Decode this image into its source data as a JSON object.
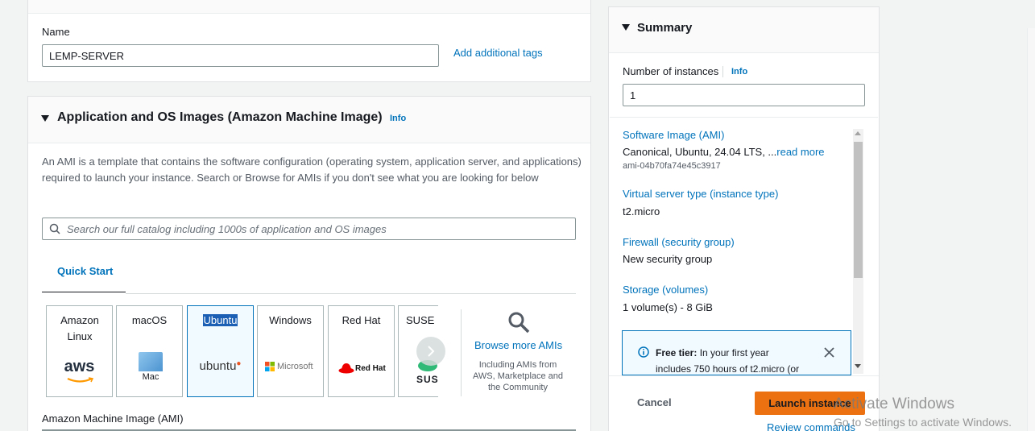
{
  "name_section": {
    "label": "Name",
    "value": "LEMP-SERVER",
    "add_tags": "Add additional tags"
  },
  "ami_section": {
    "title": "Application and OS Images (Amazon Machine Image)",
    "info": "Info",
    "description": "An AMI is a template that contains the software configuration (operating system, application server, and applications) required to launch your instance. Search or Browse for AMIs if you don't see what you are looking for below",
    "search_placeholder": "Search our full catalog including 1000s of application and OS images",
    "tab": "Quick Start",
    "tiles": [
      {
        "name": "Amazon Linux",
        "logo": "aws"
      },
      {
        "name": "macOS",
        "logo": "Mac"
      },
      {
        "name": "Ubuntu",
        "logo": "ubuntu"
      },
      {
        "name": "Windows",
        "logo": "Microsoft"
      },
      {
        "name": "Red Hat",
        "logo": "Red Hat"
      },
      {
        "name": "SUSE L",
        "logo": "SUS"
      }
    ],
    "browse_more": "Browse more AMIs",
    "browse_sub": "Including AMIs from AWS, Marketplace and the Community",
    "ami_label": "Amazon Machine Image (AMI)"
  },
  "summary": {
    "title": "Summary",
    "instances_label": "Number of instances",
    "info": "Info",
    "instances_value": "1",
    "software_image_label": "Software Image (AMI)",
    "software_image_value": "Canonical, Ubuntu, 24.04 LTS, ...",
    "read_more": "read more",
    "ami_id": "ami-04b70fa74e45c3917",
    "instance_type_label": "Virtual server type (instance type)",
    "instance_type_value": "t2.micro",
    "firewall_label": "Firewall (security group)",
    "firewall_value": "New security group",
    "storage_label": "Storage (volumes)",
    "storage_value": "1 volume(s) - 8 GiB",
    "free_tier_bold": "Free tier:",
    "free_tier_text": " In your first year",
    "free_tier_line2": "includes 750 hours of t2.micro (or",
    "cancel": "Cancel",
    "launch": "Launch instance",
    "review": "Review commands"
  },
  "watermark": {
    "line1": "Activate Windows",
    "line2": "Go to Settings to activate Windows."
  },
  "colors": {
    "link": "#0073bb",
    "launch_bg": "#ec7211",
    "info_border": "#0073bb",
    "info_bg": "#f1faff"
  }
}
